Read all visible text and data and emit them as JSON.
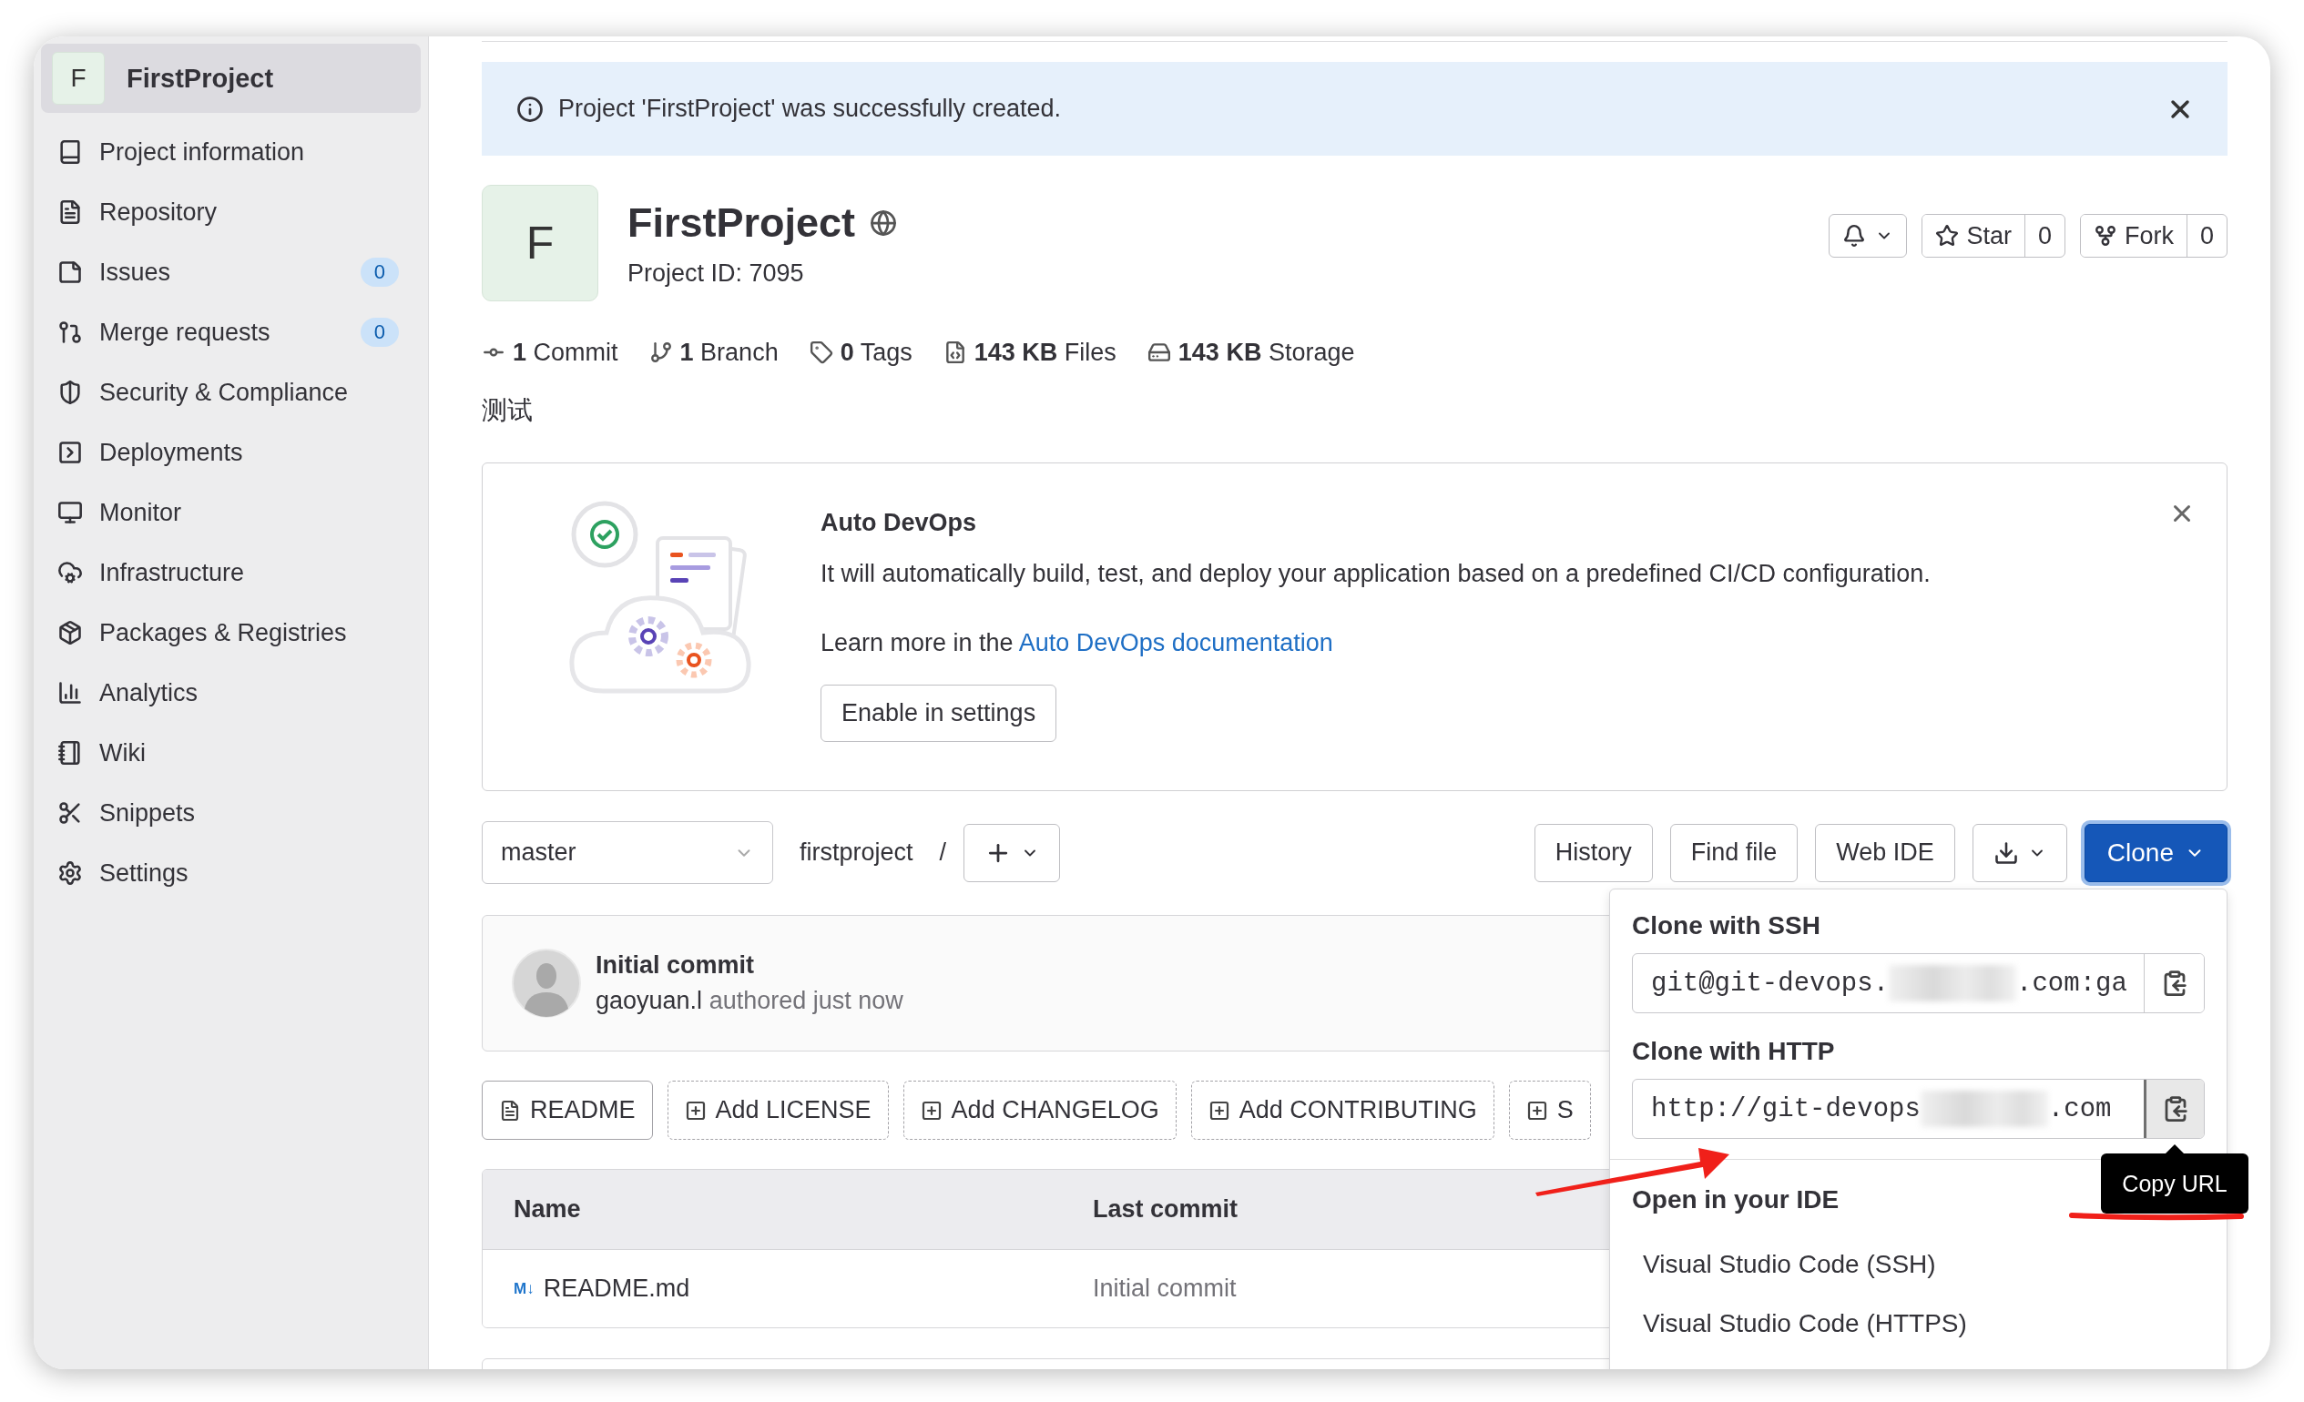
{
  "sidebar": {
    "project": {
      "letter": "F",
      "name": "FirstProject",
      "selected": true
    },
    "items": [
      {
        "label": "Project information",
        "selected": false
      },
      {
        "label": "Repository",
        "selected": false
      },
      {
        "label": "Issues",
        "badge": "0",
        "selected": false
      },
      {
        "label": "Merge requests",
        "badge": "0",
        "selected": false
      },
      {
        "label": "Security & Compliance",
        "selected": false
      },
      {
        "label": "Deployments",
        "selected": false
      },
      {
        "label": "Monitor",
        "selected": false
      },
      {
        "label": "Infrastructure",
        "selected": false
      },
      {
        "label": "Packages & Registries",
        "selected": false
      },
      {
        "label": "Analytics",
        "selected": false
      },
      {
        "label": "Wiki",
        "selected": false
      },
      {
        "label": "Snippets",
        "selected": false
      },
      {
        "label": "Settings",
        "selected": false
      }
    ]
  },
  "alert": {
    "message": "Project 'FirstProject' was successfully created."
  },
  "project": {
    "letter": "F",
    "name": "FirstProject",
    "id_label": "Project ID: 7095",
    "actions": [
      {
        "label": "Star",
        "count": "0"
      },
      {
        "label": "Fork",
        "count": "0"
      }
    ]
  },
  "stats": [
    {
      "value": "1",
      "label": "Commit"
    },
    {
      "value": "1",
      "label": "Branch"
    },
    {
      "value": "0",
      "label": "Tags"
    },
    {
      "value": "143 KB",
      "label": "Files"
    },
    {
      "value": "143 KB",
      "label": "Storage"
    }
  ],
  "description": "测试",
  "auto_devops": {
    "title": "Auto DevOps",
    "text": "It will automatically build, test, and deploy your application based on a predefined CI/CD configuration.",
    "learn_more": "Learn more in the",
    "link": "Auto DevOps documentation",
    "button": "Enable in settings"
  },
  "repo_toolbar": {
    "branch": "master",
    "path": "firstproject",
    "separator": "/",
    "buttons": [
      "History",
      "Find file",
      "Web IDE"
    ],
    "clone": {
      "label": "Clone",
      "expanded": true
    }
  },
  "last_commit": {
    "title": "Initial commit",
    "author": "gaoyuan.l",
    "meta": "authored just now"
  },
  "file_buttons": [
    {
      "label": "README",
      "kind": "existing"
    },
    {
      "label": "Add LICENSE",
      "kind": "add"
    },
    {
      "label": "Add CHANGELOG",
      "kind": "add"
    },
    {
      "label": "Add CONTRIBUTING",
      "kind": "add"
    },
    {
      "label": "S",
      "kind": "add"
    }
  ],
  "table": {
    "columns": [
      "Name",
      "Last commit"
    ],
    "rows": [
      {
        "icon": "M↓",
        "name": "README.md",
        "last_commit": "Initial commit"
      }
    ]
  },
  "clone_menu": {
    "sections": [
      {
        "title": "Clone with SSH",
        "url_start": "git@git-devops.",
        "url_end": ".com:ga",
        "hovered": false
      },
      {
        "title": "Clone with HTTP",
        "url_start": "http://git-devops",
        "url_end": ".com",
        "hovered": true
      }
    ],
    "ide_title": "Open in your IDE",
    "ide_items": [
      "Visual Studio Code (SSH)",
      "Visual Studio Code (HTTPS)"
    ]
  },
  "tooltip": "Copy URL"
}
